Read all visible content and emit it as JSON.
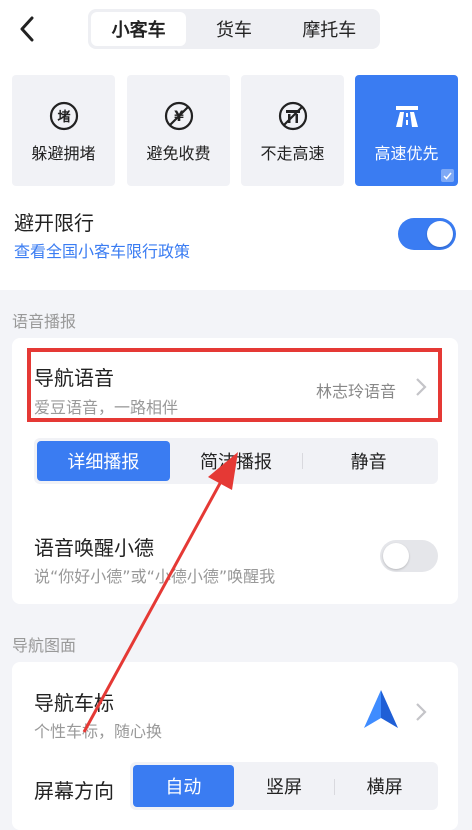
{
  "vehicle_tabs": [
    "小客车",
    "货车",
    "摩托车"
  ],
  "route_prefs": [
    {
      "label": "躲避拥堵",
      "icon": "congestion-icon"
    },
    {
      "label": "避免收费",
      "icon": "yen-icon"
    },
    {
      "label": "不走高速",
      "icon": "no-highway-icon"
    },
    {
      "label": "高速优先",
      "icon": "highway-icon",
      "selected": true
    }
  ],
  "restriction": {
    "title": "避开限行",
    "link": "查看全国小客车限行政策",
    "enabled": true
  },
  "voice_section": {
    "label": "语音播报",
    "nav_voice": {
      "title": "导航语音",
      "subtitle": "爱豆语音，一路相伴",
      "value": "林志玲语音"
    },
    "broadcast_modes": [
      "详细播报",
      "简洁播报",
      "静音"
    ],
    "broadcast_selected": "详细播报",
    "wake": {
      "title": "语音唤醒小德",
      "subtitle": "说“你好小德”或“小德小德”唤醒我",
      "enabled": false
    }
  },
  "nav_section": {
    "label": "导航图面",
    "marker": {
      "title": "导航车标",
      "subtitle": "个性车标，随心换"
    },
    "screen": {
      "label": "屏幕方向",
      "options": [
        "自动",
        "竖屏",
        "横屏"
      ],
      "selected": "自动"
    }
  },
  "colors": {
    "accent": "#3a7cf2",
    "highlight": "#e53935"
  }
}
